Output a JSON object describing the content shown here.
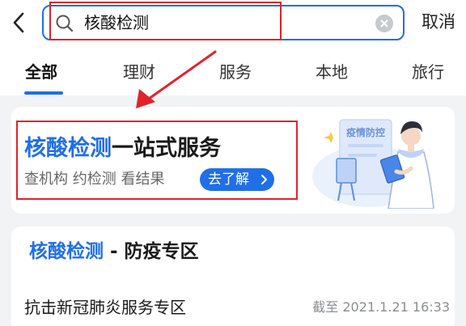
{
  "header": {
    "search_value": "核酸检测",
    "cancel_label": "取消"
  },
  "tabs": [
    {
      "label": "全部",
      "active": true
    },
    {
      "label": "理财"
    },
    {
      "label": "服务"
    },
    {
      "label": "本地"
    },
    {
      "label": "旅行"
    }
  ],
  "banner": {
    "title_highlight": "核酸检测",
    "title_rest": "一站式服务",
    "subtitle": "查机构 约检测 看结果",
    "button_label": "去了解",
    "illustration_sign": "疫情防控"
  },
  "section": {
    "title_highlight": "核酸检测",
    "title_rest": " - 防疫专区",
    "items": [
      {
        "label": "抗击新冠肺炎服务专区",
        "deadline": "截至 2021.1.21 16:33"
      }
    ]
  },
  "colors": {
    "accent": "#1f6fe8",
    "annotation_red": "#e0242b",
    "background": "#f2f3f5"
  },
  "icons": {
    "back": "chevron-left-icon",
    "search": "search-icon",
    "clear": "clear-icon",
    "button_chevron": "chevron-right-icon"
  }
}
